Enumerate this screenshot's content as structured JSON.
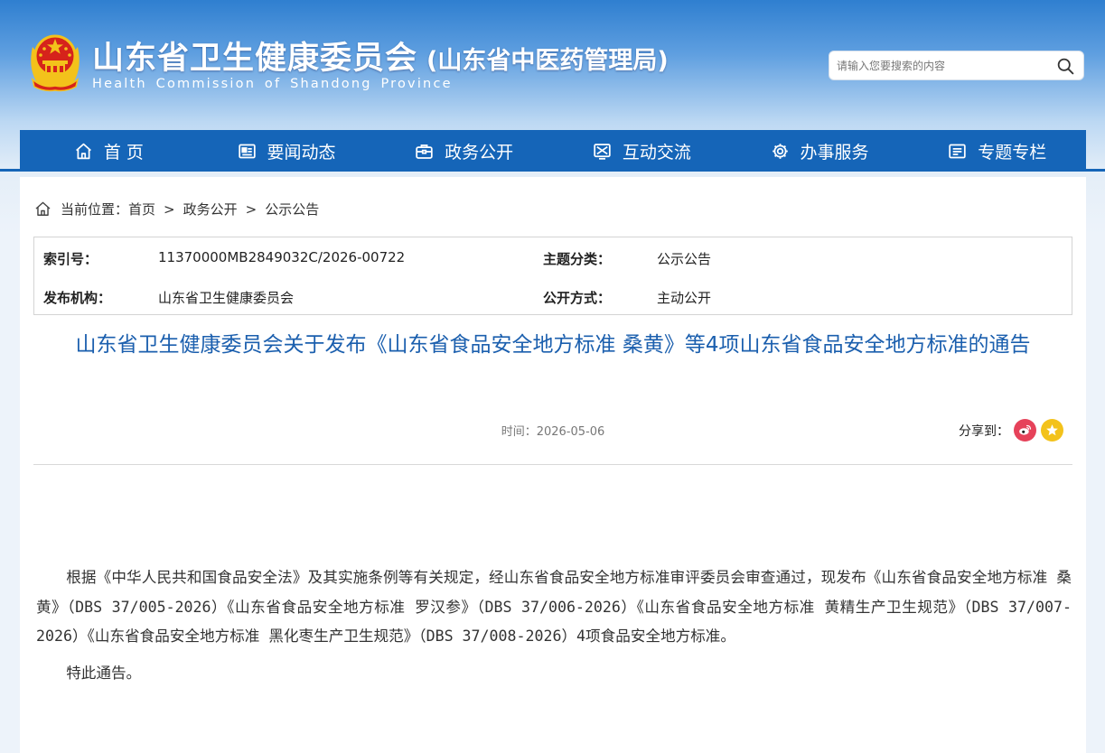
{
  "header": {
    "title": "山东省卫生健康委员会",
    "subtitle": "(山东省中医药管理局)",
    "english": "Health Commission of Shandong Province",
    "emblem_icon": "national-emblem-icon"
  },
  "search": {
    "placeholder": "请输入您要搜索的内容",
    "value": "",
    "icon": "search-icon"
  },
  "nav": {
    "items": [
      {
        "label": "首 页",
        "icon": "home-icon"
      },
      {
        "label": "要闻动态",
        "icon": "news-icon"
      },
      {
        "label": "政务公开",
        "icon": "briefcase-icon"
      },
      {
        "label": "互动交流",
        "icon": "interact-icon"
      },
      {
        "label": "办事服务",
        "icon": "service-icon"
      },
      {
        "label": "专题专栏",
        "icon": "topic-icon"
      }
    ]
  },
  "breadcrumb": {
    "prefix": "当前位置：",
    "items": [
      "首页",
      "政务公开",
      "公示公告"
    ],
    "separator": ">"
  },
  "meta": {
    "index_label": "索引号：",
    "index_value": "11370000MB2849032C/2026-00722",
    "topic_label": "主题分类：",
    "topic_value": "公示公告",
    "org_label": "发布机构：",
    "org_value": "山东省卫生健康委员会",
    "method_label": "公开方式：",
    "method_value": "主动公开"
  },
  "article": {
    "title": "山东省卫生健康委员会关于发布《山东省食品安全地方标准 桑黄》等4项山东省食品安全地方标准的通告",
    "time": "时间：2026-05-06",
    "paragraphs": [
      "根据《中华人民共和国食品安全法》及其实施条例等有关规定，经山东省食品安全地方标准审评委员会审查通过，现发布《山东省食品安全地方标准 桑黄》（DBS 37/005-2026）《山东省食品安全地方标准 罗汉参》（DBS 37/006-2026）《山东省食品安全地方标准  黄精生产卫生规范》（DBS 37/007-2026）《山东省食品安全地方标准 黑化枣生产卫生规范》（DBS 37/008-2026）4项食品安全地方标准。",
      "特此通告。"
    ]
  },
  "share": {
    "label": "分享到：",
    "items": [
      {
        "icon": "weibo-icon",
        "color": "#e6425a"
      },
      {
        "icon": "favorite-star-icon",
        "color": "#f3c21b"
      }
    ]
  },
  "colors": {
    "nav": "#1565b8",
    "title": "#1b5fae",
    "emblem_red": "#d6231b",
    "emblem_gold": "#f3c21b"
  }
}
